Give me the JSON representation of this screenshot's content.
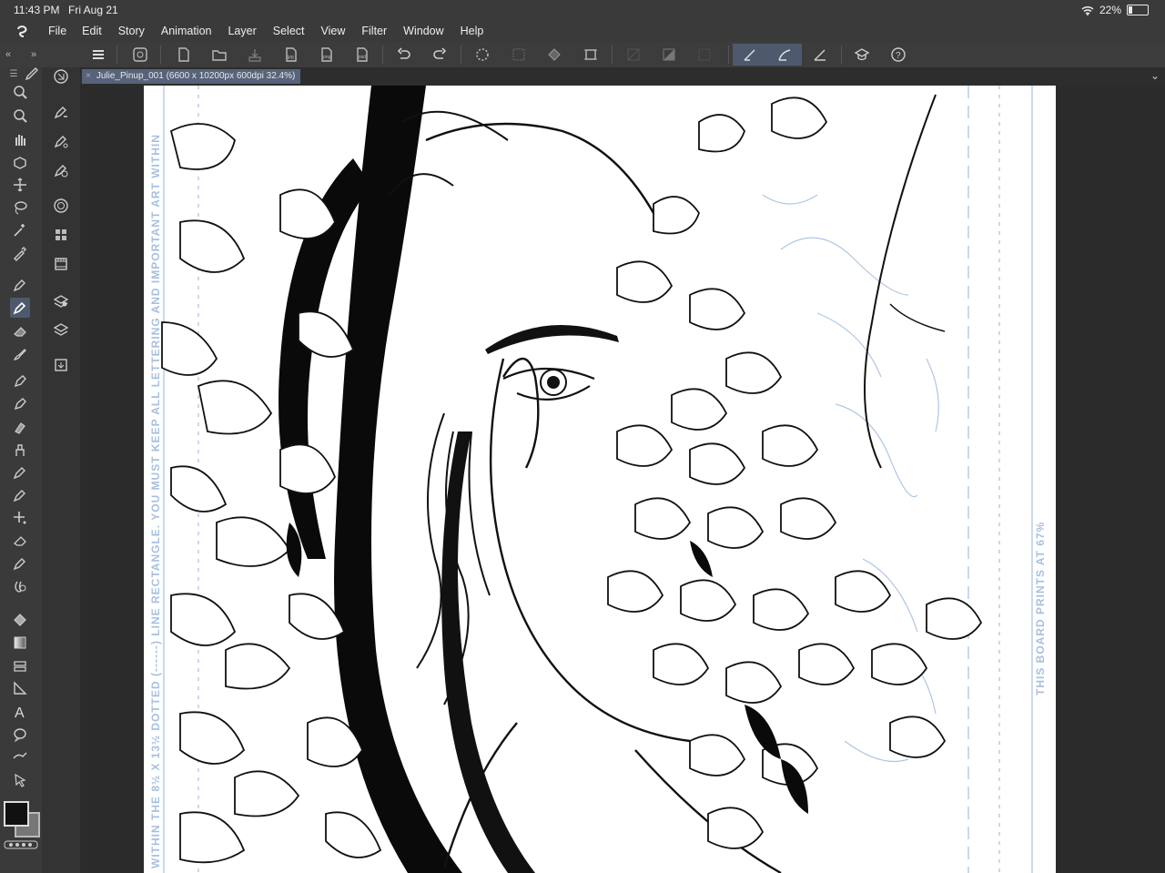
{
  "status": {
    "time": "11:43 PM",
    "date": "Fri Aug 21",
    "battery": "22%",
    "battery_level": 0.22
  },
  "menu": [
    "File",
    "Edit",
    "Story",
    "Animation",
    "Layer",
    "Select",
    "View",
    "Filter",
    "Window",
    "Help"
  ],
  "document": {
    "tab_title": "Julie_Pinup_001 (6600 x 10200px 600dpi 32.4%)"
  },
  "board": {
    "left_text": "WITHIN THE 8½ X 13½ DOTTED (------) LINE RECTANGLE. YOU MUST KEEP ALL LETTERING AND IMPORTANT ART WITHIN",
    "right_text": "THIS BOARD PRINTS AT 67%"
  },
  "colors": {
    "accent": "#4d5a6e",
    "foreground": "#111111",
    "background": "#777777",
    "blueline": "#a8c0de"
  },
  "icons": {
    "app": "clip-studio-logo-icon",
    "wifi": "wifi-icon",
    "battery": "battery-icon",
    "tools": [
      "pen-tool",
      "zoom-tool",
      "zoom-tool",
      "hand-tool",
      "rotate-tool",
      "move-tool",
      "lasso-tool",
      "magic-wand-tool",
      "eyedropper-tool",
      "pen-tool",
      "pencil-tool",
      "eraser-tool",
      "brush-tool",
      "marker-tool",
      "airbrush-tool",
      "decoration-tool",
      "blend-tool",
      "spray-tool",
      "sparkle-tool",
      "eraser2-tool",
      "correction-tool",
      "fill-tool",
      "gradient-tool",
      "figure-tool",
      "frame-tool",
      "ruler-tool",
      "text-tool",
      "balloon-tool",
      "line-correction-tool",
      "operation-tool"
    ]
  }
}
